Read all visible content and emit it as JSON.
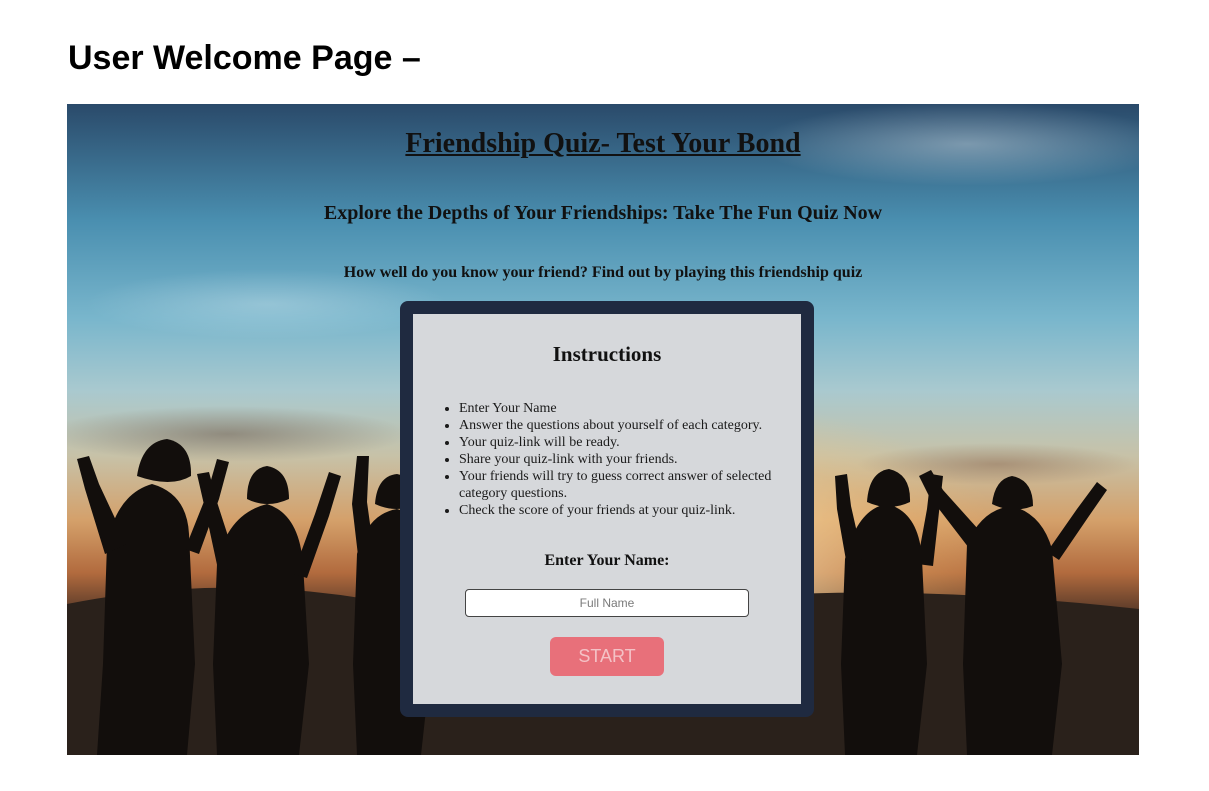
{
  "document": {
    "heading": "User Welcome Page –"
  },
  "app": {
    "title": "Friendship Quiz- Test Your Bond",
    "subtitle": "Explore the Depths of Your Friendships: Take The Fun Quiz Now",
    "tagline": "How well do you know your friend? Find out by playing this friendship quiz"
  },
  "instructions": {
    "heading": "Instructions",
    "items": [
      "Enter Your Name",
      "Answer the questions about yourself of each category.",
      "Your quiz-link will be ready.",
      "Share your quiz-link with your friends.",
      "Your friends will try to guess correct answer of selected category questions.",
      "Check the score of your friends at your quiz-link."
    ]
  },
  "form": {
    "name_label": "Enter Your Name:",
    "name_placeholder": "Full Name",
    "name_value": "",
    "start_label": "START"
  },
  "colors": {
    "card_frame": "#1f2a40",
    "start_button": "#e8707a"
  }
}
